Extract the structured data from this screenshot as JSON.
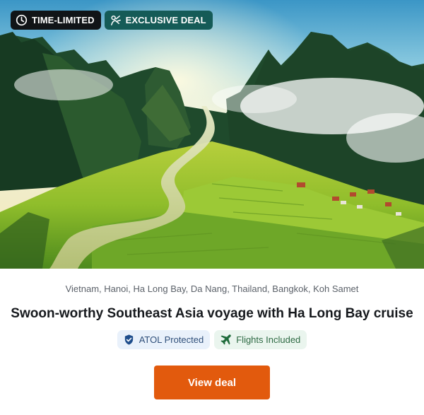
{
  "badges": {
    "time_limited": {
      "label": "TIME-LIMITED",
      "icon": "clock-icon"
    },
    "exclusive": {
      "label": "EXCLUSIVE DEAL",
      "icon": "exclusive-deal-icon"
    }
  },
  "deal": {
    "destinations": "Vietnam, Hanoi, Ha Long Bay, Da Nang, Thailand, Bangkok, Koh Samet",
    "title": "Swoon-worthy Southeast Asia voyage with Ha Long Bay cruise",
    "tags": {
      "atol": {
        "label": "ATOL Protected",
        "icon": "shield-check-icon"
      },
      "flights": {
        "label": "Flights Included",
        "icon": "airplane-icon"
      }
    },
    "cta_label": "View deal"
  },
  "colors": {
    "cta": "#e25a0d",
    "badge_dark": "#111417",
    "badge_teal": "#155b57"
  }
}
